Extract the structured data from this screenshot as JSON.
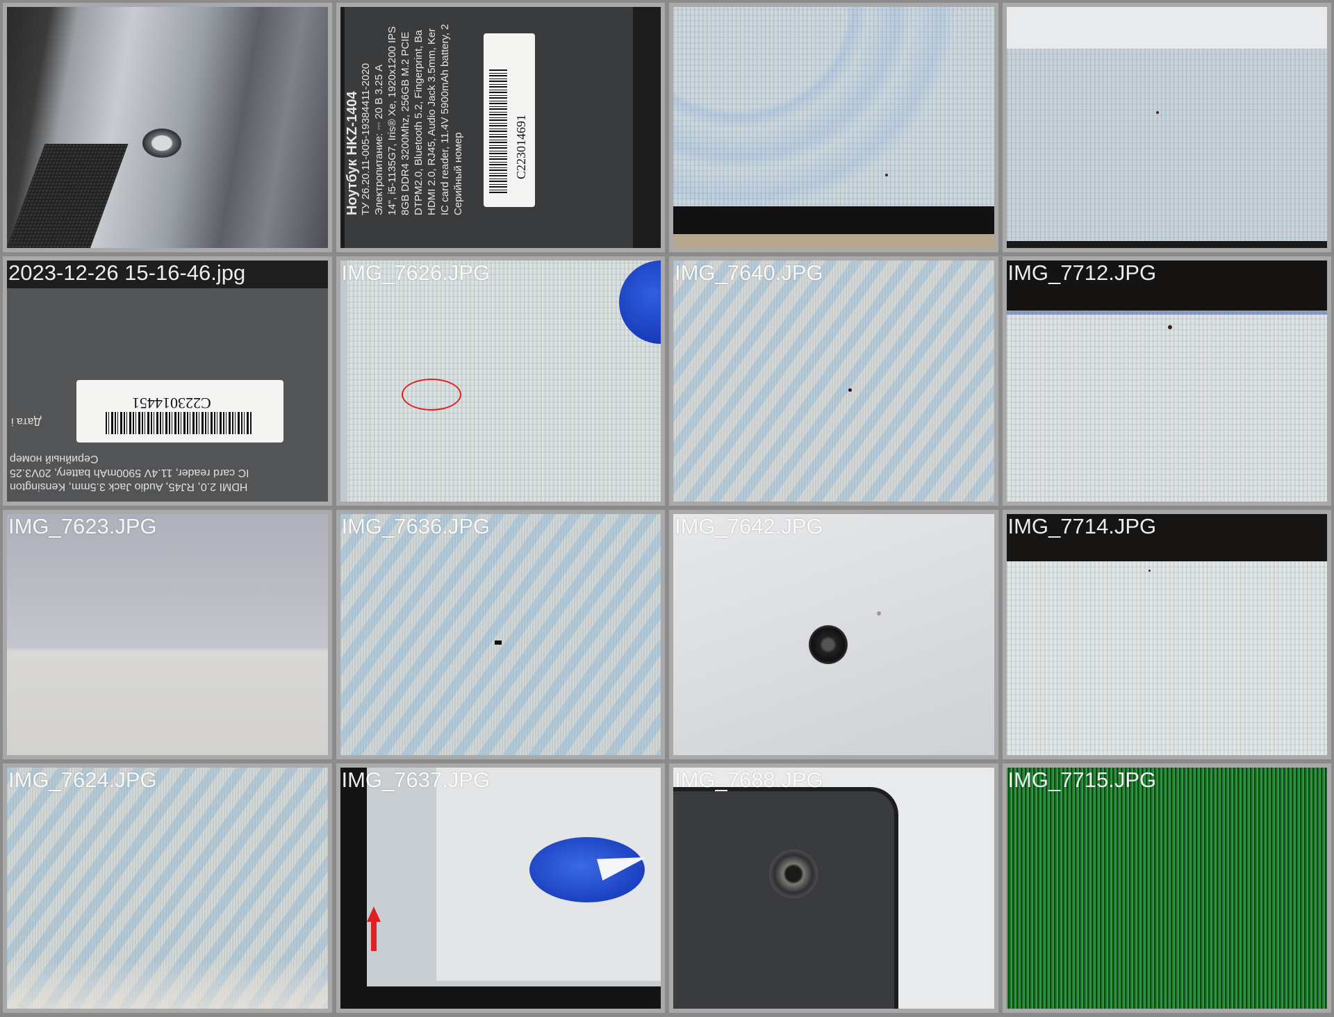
{
  "gallery": {
    "cells": [
      {
        "filename": "",
        "subject": "screw-on-chassis"
      },
      {
        "filename": "",
        "subject": "spec-label"
      },
      {
        "filename": "",
        "subject": "screen-moire-corner"
      },
      {
        "filename": "",
        "subject": "screen-edge-dot"
      },
      {
        "filename": "2023-12-26 15-16-46.jpg",
        "subject": "serial-label-upside-down"
      },
      {
        "filename": "IMG_7626.JPG",
        "subject": "screen-circled-defect"
      },
      {
        "filename": "IMG_7640.JPG",
        "subject": "screen-pixel-dot"
      },
      {
        "filename": "IMG_7712.JPG",
        "subject": "screen-top-edge-dot"
      },
      {
        "filename": "IMG_7623.JPG",
        "subject": "screen-gradient"
      },
      {
        "filename": "IMG_7636.JPG",
        "subject": "screen-dead-pixel"
      },
      {
        "filename": "IMG_7642.JPG",
        "subject": "loose-screw"
      },
      {
        "filename": "IMG_7714.JPG",
        "subject": "screen-top-edge"
      },
      {
        "filename": "IMG_7624.JPG",
        "subject": "screen-moire"
      },
      {
        "filename": "IMG_7637.JPG",
        "subject": "screen-logo-arrow"
      },
      {
        "filename": "IMG_7688.JPG",
        "subject": "chassis-corner-screw"
      },
      {
        "filename": "IMG_7715.JPG",
        "subject": "screen-green-lines"
      }
    ]
  },
  "spec_label": {
    "title": "Ноутбук HKZ-1404",
    "lines": [
      "ТУ 26.20.11-005-19384411-2020",
      "Электропитание: ⎓ 20 В 3.25 А",
      "14\", i5-1135G7, Iris® Xe, 1920x1200 IPS",
      "8GB DDR4 3200Mhz, 256GB M.2 PCIE",
      "DTPM2.0, Bluetooth 5.2, Fingerprint, Ba",
      "HDMI 2.0, RJ45, Audio Jack 3.5mm, Ker",
      "IC card reader, 11.4V 5900mAh battery, 2",
      "Серийный номер"
    ],
    "serial": "C223014691"
  },
  "serial_label": {
    "serial": "C223014451",
    "date_label": "Дата і",
    "lines": [
      "Серийный номер",
      "IC card reader, 11.4V 5900mAh battery, 20V3.25",
      "HDMI 2.0, RJ45, Audio Jack 3.5mm, Kensington"
    ]
  },
  "colors": {
    "background": "#8a8a8a",
    "cell_border": "#a9a9a9",
    "annotation_red": "#e02020",
    "globe_blue": "#1f3fbf"
  }
}
